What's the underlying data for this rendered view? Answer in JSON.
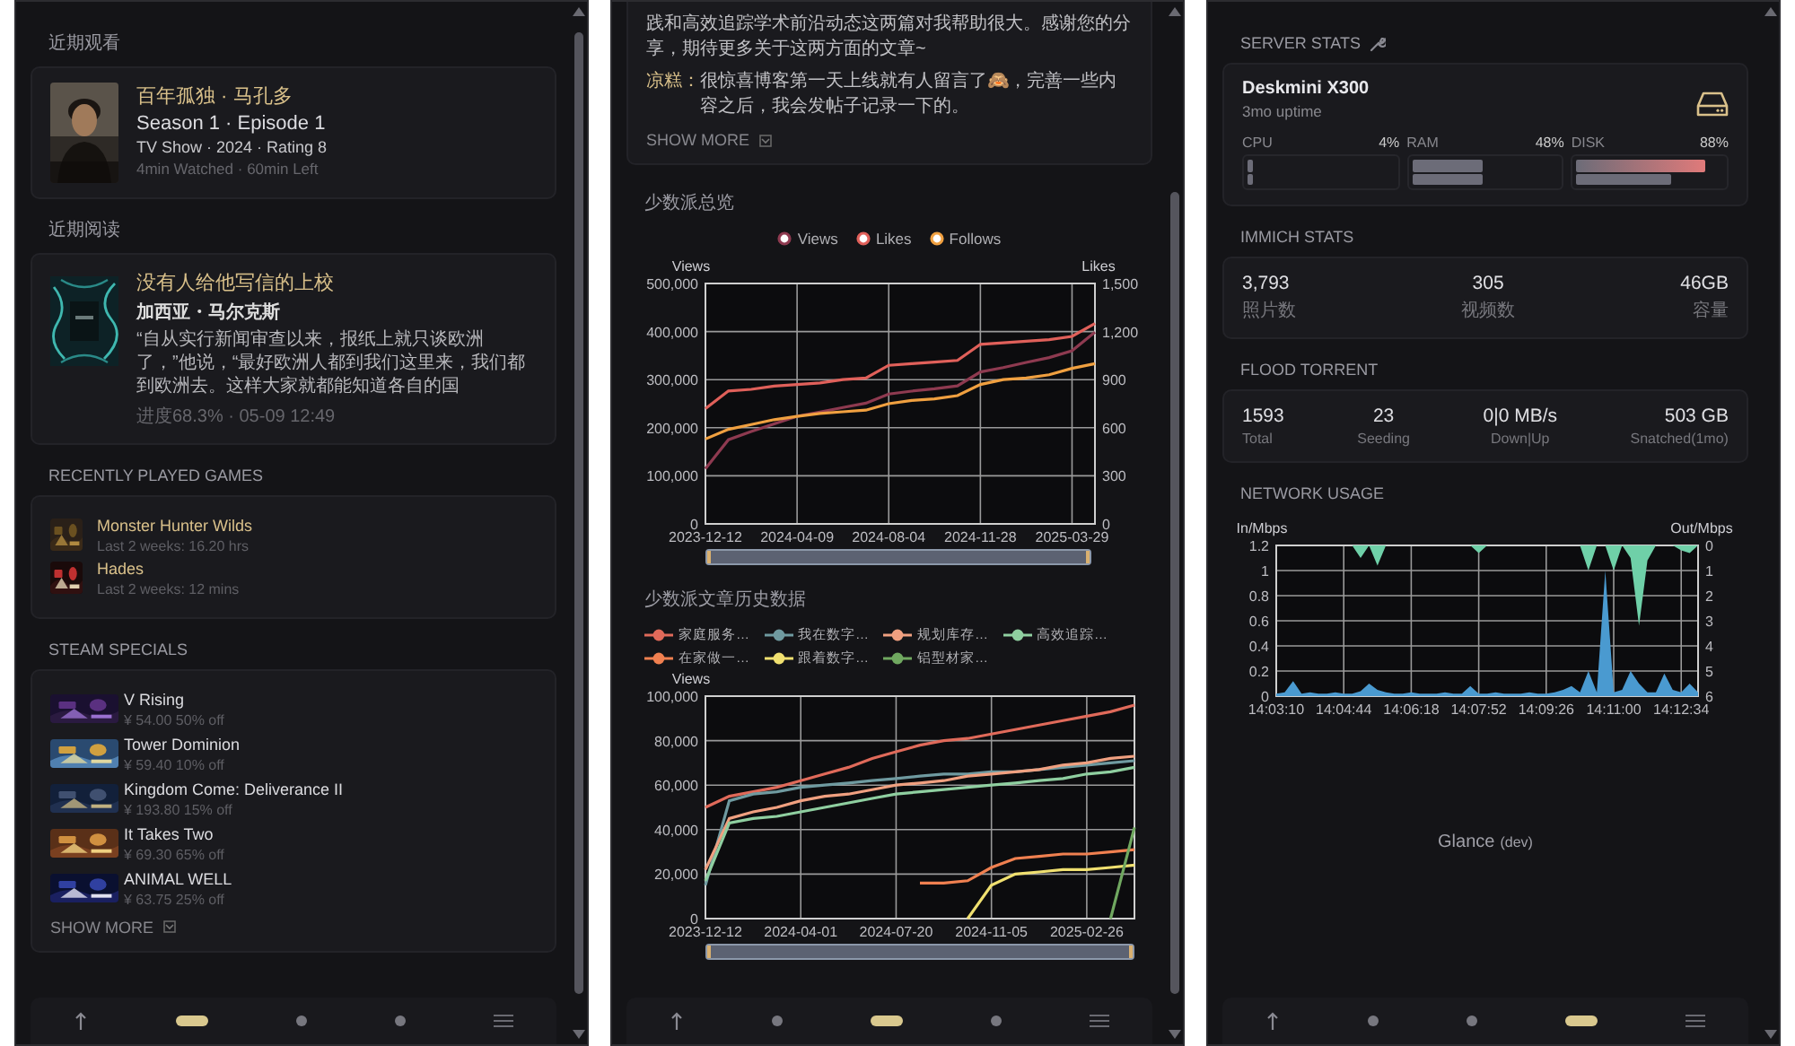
{
  "left_column": {
    "watching": {
      "title": "近期观看",
      "show": "百年孤独 · 马孔多",
      "episode": "Season 1 · Episode 1",
      "meta": "TV Show · 2024 · Rating 8",
      "watch_time": "4min Watched · 60min Left"
    },
    "reading": {
      "title": "近期阅读",
      "book": "没有人给他写信的上校",
      "author": "加西亚・马尔克斯",
      "excerpt": "“自从实行新闻审查以来，报纸上就只谈欧洲了，”他说，“最好欧洲人都到我们这里来，我们都到欧洲去。这样大家就都能知道各自的国",
      "status": "进度68.3% · 05-09 12:49"
    },
    "games": {
      "title": "RECENTLY PLAYED GAMES",
      "items": [
        {
          "name": "Monster Hunter Wilds",
          "playtime": "Last 2 weeks: 16.20 hrs"
        },
        {
          "name": "Hades",
          "playtime": "Last 2 weeks: 12 mins"
        }
      ]
    },
    "specials": {
      "title": "STEAM SPECIALS",
      "items": [
        {
          "name": "V Rising",
          "price": "¥ 54.00 50% off"
        },
        {
          "name": "Tower Dominion",
          "price": "¥ 59.40 10% off"
        },
        {
          "name": "Kingdom Come: Deliverance II",
          "price": "¥ 193.80 15% off"
        },
        {
          "name": "It Takes Two",
          "price": "¥ 69.30 65% off"
        },
        {
          "name": "ANIMAL WELL",
          "price": "¥ 63.75 25% off"
        }
      ],
      "show_more": "SHOW MORE"
    },
    "nav": [
      {
        "kind": "top"
      },
      {
        "kind": "page",
        "selected": true
      },
      {
        "kind": "page",
        "selected": false
      },
      {
        "kind": "page",
        "selected": false
      },
      {
        "kind": "menu"
      }
    ]
  },
  "middle_column": {
    "comments": [
      {
        "text": "践和高效追踪学术前沿动态这两篇对我帮助很大。感谢您的分享，期待更多关于这两方面的文章~"
      },
      {
        "author": "凉糕：",
        "text": "很惊喜博客第一天上线就有人留言了🙈，完善一些内容之后，我会发帖子记录一下的。"
      }
    ],
    "show_more": "SHOW MORE",
    "overview": {
      "title": "少数派总览",
      "slider": {
        "level": 1
      },
      "chart_data": {
        "type": "line",
        "grid": true,
        "legend": "top",
        "ylabel": "Views",
        "y2label": "Likes",
        "ylim": [
          0,
          500000
        ],
        "y2lim": [
          0,
          1500
        ],
        "categories": [
          "2023-12-12",
          null,
          null,
          null,
          "2024-04-09",
          null,
          null,
          null,
          "2024-08-04",
          null,
          null,
          null,
          "2024-11-28",
          null,
          null,
          null,
          "2025-03-29",
          null
        ],
        "yticks": [
          {
            "value": 0,
            "label": "0"
          },
          {
            "value": 100000,
            "label": "100,000"
          },
          {
            "value": 200000,
            "label": "200,000"
          },
          {
            "value": 300000,
            "label": "300,000"
          },
          {
            "value": 400000,
            "label": "400,000"
          },
          {
            "value": 500000,
            "label": "500,000"
          }
        ],
        "y2ticks": [
          {
            "value": 0,
            "label": "0"
          },
          {
            "value": 300,
            "label": "300"
          },
          {
            "value": 600,
            "label": "600"
          },
          {
            "value": 900,
            "label": "900"
          },
          {
            "value": 1200,
            "label": "1,200"
          },
          {
            "value": 1500,
            "label": "1,500"
          }
        ],
        "series": [
          {
            "name": "Views",
            "color": "#8e3a50",
            "values": [
              115000,
              175000,
              192000,
              208000,
              224000,
              233000,
              242000,
              251000,
              270000,
              276000,
              281000,
              287000,
              316000,
              325000,
              336000,
              346000,
              360000,
              399000
            ]
          },
          {
            "name": "Likes",
            "color": "#e0605a",
            "axis": "y2",
            "values": [
              720,
              830,
              840,
              860,
              870,
              880,
              900,
              910,
              990,
              1000,
              1010,
              1020,
              1120,
              1130,
              1140,
              1150,
              1170,
              1250
            ]
          },
          {
            "name": "Follows",
            "color": "#f0a040",
            "axis": "y2",
            "values": [
              530,
              590,
              620,
              650,
              670,
              690,
              700,
              710,
              750,
              770,
              780,
              800,
              870,
              900,
              910,
              930,
              970,
              1000
            ]
          }
        ]
      }
    },
    "history": {
      "title": "少数派文章历史数据",
      "slider": {
        "level": 1
      },
      "chart_data": {
        "type": "line",
        "grid": true,
        "legend": "top-left",
        "ylabel": "Views",
        "ylim": [
          0,
          100000
        ],
        "categories": [
          "2023-12-12",
          null,
          null,
          null,
          "2024-04-01",
          null,
          null,
          null,
          "2024-07-20",
          null,
          null,
          null,
          "2024-11-05",
          null,
          null,
          null,
          "2025-02-26",
          null,
          null
        ],
        "yticks": [
          {
            "value": 0,
            "label": "0"
          },
          {
            "value": 20000,
            "label": "20,000"
          },
          {
            "value": 40000,
            "label": "40,000"
          },
          {
            "value": 60000,
            "label": "60,000"
          },
          {
            "value": 80000,
            "label": "80,000"
          },
          {
            "value": 100000,
            "label": "100,000"
          }
        ],
        "series": [
          {
            "name": "家庭服务…",
            "color": "#e06a5a",
            "values": [
              50000,
              55000,
              57000,
              59000,
              62000,
              65000,
              68000,
              72000,
              75000,
              78000,
              80000,
              81000,
              83000,
              85000,
              87000,
              89000,
              91000,
              93000,
              96000
            ]
          },
          {
            "name": "我在数字…",
            "color": "#6f9aa0",
            "values": [
              15000,
              53000,
              56000,
              57000,
              59000,
              60000,
              61000,
              62000,
              63000,
              64000,
              65000,
              65000,
              66000,
              66000,
              67000,
              68000,
              69000,
              70000,
              71000
            ]
          },
          {
            "name": "规划库存…",
            "color": "#f0a080",
            "values": [
              22000,
              45000,
              48000,
              50000,
              53000,
              55000,
              56000,
              58000,
              60000,
              61000,
              62000,
              64000,
              65000,
              66000,
              67000,
              69000,
              70000,
              72000,
              73000
            ]
          },
          {
            "name": "高效追踪…",
            "color": "#8fcfa0",
            "values": [
              17000,
              43000,
              45000,
              46000,
              48000,
              50000,
              52000,
              54000,
              56000,
              57000,
              58000,
              59000,
              60000,
              61000,
              62000,
              63000,
              65000,
              66000,
              68000
            ]
          },
          {
            "name": "在家做一…",
            "color": "#f08050",
            "values": [
              null,
              null,
              null,
              null,
              null,
              null,
              null,
              null,
              null,
              16000,
              16000,
              17000,
              23000,
              27000,
              28000,
              29000,
              29000,
              30000,
              31000
            ]
          },
          {
            "name": "跟着数字…",
            "color": "#f0e070",
            "values": [
              null,
              null,
              null,
              null,
              null,
              null,
              null,
              null,
              null,
              null,
              null,
              0,
              15000,
              20000,
              21000,
              22000,
              22000,
              23000,
              24000
            ]
          },
          {
            "name": "铝型材家…",
            "color": "#70a860",
            "values": [
              null,
              null,
              null,
              null,
              null,
              null,
              null,
              null,
              null,
              null,
              null,
              null,
              null,
              null,
              null,
              null,
              null,
              0,
              41000
            ]
          }
        ]
      }
    },
    "nav": [
      {
        "kind": "top"
      },
      {
        "kind": "page",
        "selected": false
      },
      {
        "kind": "page",
        "selected": true
      },
      {
        "kind": "page",
        "selected": false
      },
      {
        "kind": "menu"
      }
    ]
  },
  "right_column": {
    "server": {
      "title": "SERVER STATS",
      "name": "Deskmini X300",
      "uptime": "3mo uptime",
      "stats": [
        {
          "label": "CPU",
          "value": "4%",
          "bars": [
            {
              "level": 0.04
            },
            {
              "level": 0.04
            }
          ]
        },
        {
          "label": "RAM",
          "value": "48%",
          "bars": [
            {
              "level": 0.48
            },
            {
              "level": 0.48
            }
          ]
        },
        {
          "label": "DISK",
          "value": "88%",
          "bars": [
            {
              "level": 0.88
            },
            {
              "level": 0.65
            }
          ]
        }
      ]
    },
    "immich": {
      "title": "IMMICH STATS",
      "stats": [
        {
          "value": "3,793",
          "label": "照片数"
        },
        {
          "value": "305",
          "label": "视频数"
        },
        {
          "value": "46GB",
          "label": "容量"
        }
      ]
    },
    "torrent": {
      "title": "FLOOD TORRENT",
      "stats": [
        {
          "value": "1593",
          "label": "Total"
        },
        {
          "value": "23",
          "label": "Seeding"
        },
        {
          "value": "0|0 MB/s",
          "label": "Down|Up"
        },
        {
          "value": "503 GB",
          "label": "Snatched(1mo)"
        }
      ]
    },
    "network": {
      "title": "NETWORK USAGE",
      "chart_data": {
        "type": "area",
        "grid": true,
        "ylabel": "In/Mbps",
        "y2label": "Out/Mbps",
        "ylim": [
          0,
          1.2
        ],
        "y2lim": [
          6,
          0
        ],
        "categories": [
          "14:03:10",
          null,
          null,
          null,
          null,
          null,
          null,
          null,
          "14:04:44",
          null,
          null,
          null,
          null,
          null,
          null,
          null,
          "14:06:18",
          null,
          null,
          null,
          null,
          null,
          null,
          null,
          "14:07:52",
          null,
          null,
          null,
          null,
          null,
          null,
          null,
          "14:09:26",
          null,
          null,
          null,
          null,
          null,
          null,
          null,
          "14:11:00",
          null,
          null,
          null,
          null,
          null,
          null,
          null,
          "14:12:34",
          null,
          null
        ],
        "yticks": [
          {
            "value": 0,
            "label": "0"
          },
          {
            "value": 0.2,
            "label": "0.2"
          },
          {
            "value": 0.4,
            "label": "0.4"
          },
          {
            "value": 0.6,
            "label": "0.6"
          },
          {
            "value": 0.8,
            "label": "0.8"
          },
          {
            "value": 1,
            "label": "1"
          },
          {
            "value": 1.2,
            "label": "1.2"
          }
        ],
        "y2ticks": [
          0,
          1,
          2,
          3,
          4,
          5,
          6
        ],
        "series": [
          {
            "color": "#4a9ad0",
            "values": [
              0.02,
              0.03,
              0.12,
              0.02,
              0.03,
              0.02,
              0.02,
              0.03,
              0.02,
              0.02,
              0.04,
              0.1,
              0.05,
              0.03,
              0.02,
              0.02,
              0.03,
              0.02,
              0.02,
              0.02,
              0.03,
              0.02,
              0.02,
              0.08,
              0.02,
              0.02,
              0.03,
              0.02,
              0.02,
              0.02,
              0.03,
              0.02,
              0.02,
              0.03,
              0.05,
              0.08,
              0.03,
              0.2,
              0.03,
              1.0,
              0.03,
              0.05,
              0.2,
              0.1,
              0.03,
              0.03,
              0.18,
              0.05,
              0.03,
              0.1,
              0.03
            ]
          },
          {
            "color": "#6fd0a8",
            "axis": "y2",
            "values": [
              0,
              0,
              0,
              0,
              0,
              0,
              0,
              0,
              0,
              0,
              0.5,
              0,
              0.8,
              0,
              0,
              0,
              0,
              0,
              0,
              0,
              0,
              0,
              0,
              0,
              0.3,
              0,
              0,
              0,
              0,
              0,
              0,
              0,
              0,
              0,
              0,
              0,
              0,
              1.0,
              0,
              0,
              1.0,
              0,
              0.5,
              3.2,
              0.6,
              0,
              0,
              0,
              0.2,
              0.3,
              0
            ]
          }
        ]
      }
    },
    "footer": {
      "name": "Glance",
      "tag": "(dev)"
    },
    "nav": [
      {
        "kind": "top"
      },
      {
        "kind": "page",
        "selected": false
      },
      {
        "kind": "page",
        "selected": false
      },
      {
        "kind": "page",
        "selected": true
      },
      {
        "kind": "menu"
      }
    ]
  }
}
